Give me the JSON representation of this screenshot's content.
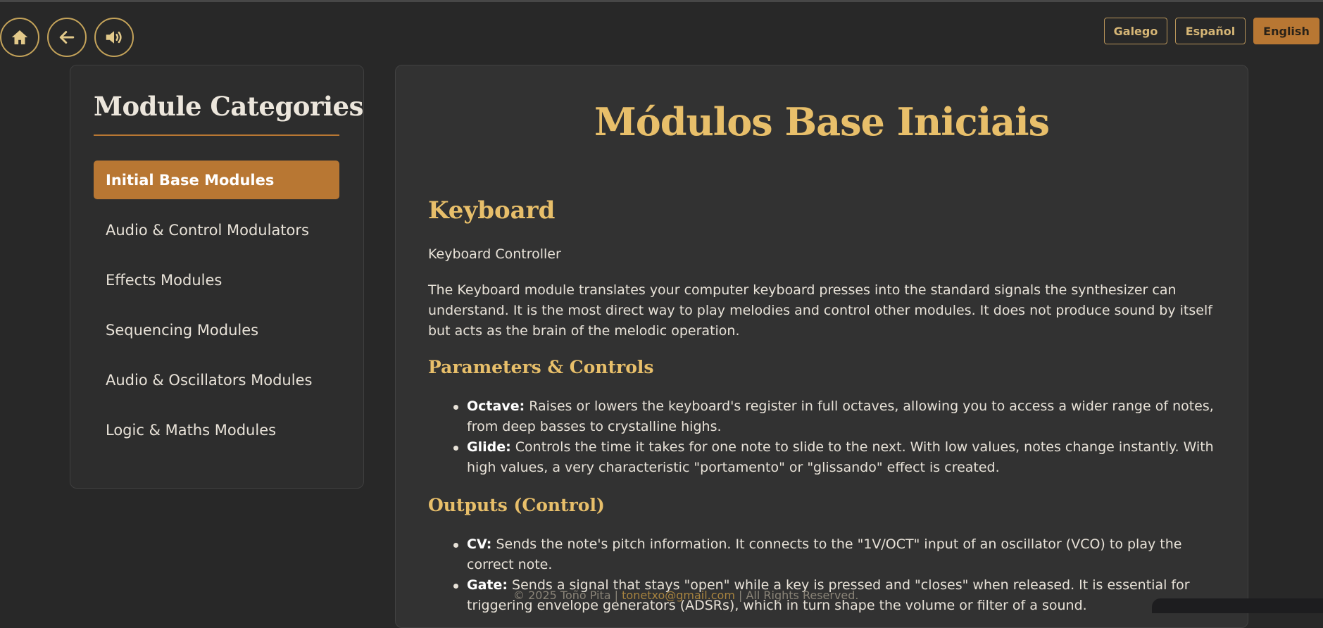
{
  "nav": {
    "home_icon": "home-icon",
    "back_icon": "arrow-left-icon",
    "sound_icon": "speaker-icon"
  },
  "languages": [
    {
      "label": "Galego",
      "active": false
    },
    {
      "label": "Español",
      "active": false
    },
    {
      "label": "English",
      "active": true
    }
  ],
  "sidebar": {
    "title": "Module Categories",
    "items": [
      {
        "label": "Initial Base Modules",
        "active": true
      },
      {
        "label": "Audio & Control Modulators",
        "active": false
      },
      {
        "label": "Effects Modules",
        "active": false
      },
      {
        "label": "Sequencing Modules",
        "active": false
      },
      {
        "label": "Audio & Oscillators Modules",
        "active": false
      },
      {
        "label": "Logic & Maths Modules",
        "active": false
      }
    ]
  },
  "main": {
    "title": "Módulos Base Iniciais",
    "section_heading": "Keyboard",
    "subtitle": "Keyboard Controller",
    "description": "The Keyboard module translates your computer keyboard presses into the standard signals the synthesizer can understand. It is the most direct way to play melodies and control other modules. It does not produce sound by itself but acts as the brain of the melodic operation.",
    "params_heading": "Parameters & Controls",
    "params": [
      {
        "term": "Octave:",
        "text": " Raises or lowers the keyboard's register in full octaves, allowing you to access a wider range of notes, from deep basses to crystalline highs."
      },
      {
        "term": "Glide:",
        "text": " Controls the time it takes for one note to slide to the next. With low values, notes change instantly. With high values, a very characteristic \"portamento\" or \"glissando\" effect is created."
      }
    ],
    "outputs_heading": "Outputs (Control)",
    "outputs": [
      {
        "term": "CV:",
        "text": " Sends the note's pitch information. It connects to the \"1V/OCT\" input of an oscillator (VCO) to play the correct note."
      },
      {
        "term": "Gate:",
        "text": " Sends a signal that stays \"open\" while a key is pressed and \"closes\" when released. It is essential for triggering envelope generators (ADSRs), which in turn shape the volume or filter of a sound."
      }
    ]
  },
  "footer": {
    "copyright": "© 2025 Toño Pita | ",
    "email": "tonetxo@gmail.com",
    "rights": " | All Rights Reserved."
  },
  "colors": {
    "background": "#282828",
    "accent": "#b87733",
    "heading_gold": "#e8bf6a",
    "panel": "#323232"
  }
}
